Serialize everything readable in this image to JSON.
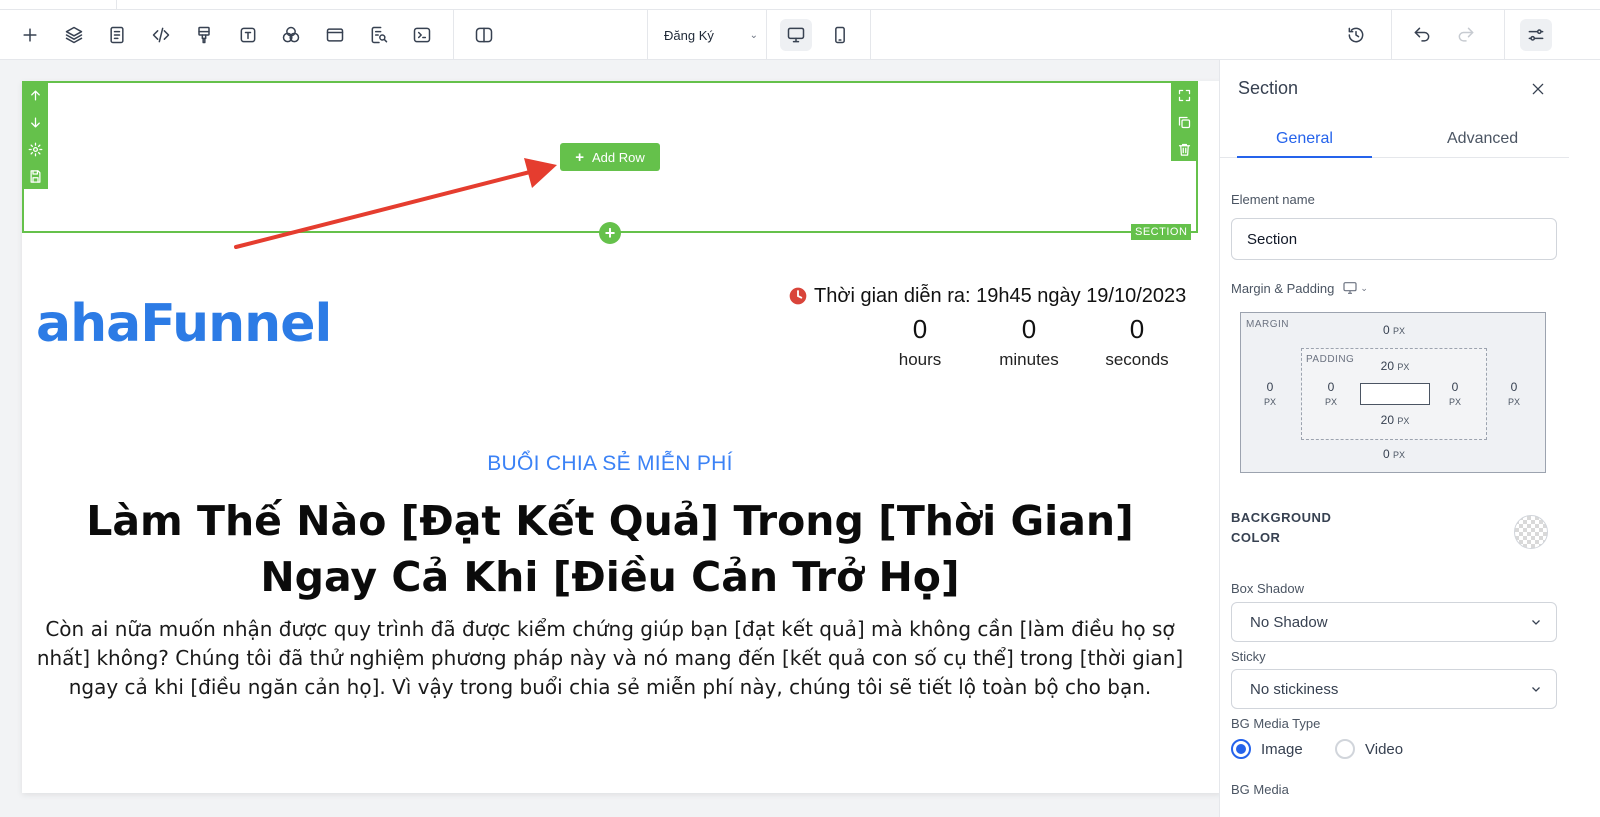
{
  "toolbar": {
    "page_select": "Đăng Ký",
    "icons": [
      "plus-icon",
      "layers-icon",
      "page-icon",
      "code-icon",
      "paint-icon",
      "text-icon",
      "theme-icon",
      "layout-icon",
      "seo-icon",
      "terminal-icon",
      "split-view-icon"
    ]
  },
  "canvas": {
    "add_row_label": "Add Row",
    "section_tag": "SECTION"
  },
  "content": {
    "logo": "ahaFunnel",
    "event_time": "Thời gian diễn ra: 19h45 ngày 19/10/2023",
    "countdown": [
      {
        "value": "0",
        "unit": "hours"
      },
      {
        "value": "0",
        "unit": "minutes"
      },
      {
        "value": "0",
        "unit": "seconds"
      }
    ],
    "subtitle": "BUỔI CHIA SẺ MIỄN PHÍ",
    "headline": "Làm Thế Nào [Đạt Kết Quả] Trong [Thời Gian] Ngay Cả Khi [Điều Cản Trở Họ]",
    "description": "Còn ai nữa muốn nhận được quy trình đã được kiểm chứng giúp bạn [đạt kết quả] mà không cần [làm điều họ sợ nhất] không? Chúng tôi đã thử nghiệm phương pháp này và nó mang đến [kết quả con số cụ thể] trong [thời gian] ngay cả khi [điều ngăn cản họ]. Vì vậy trong buổi chia sẻ miễn phí này, chúng tôi sẽ tiết lộ toàn bộ cho bạn."
  },
  "panel": {
    "title": "Section",
    "tabs": [
      "General",
      "Advanced"
    ],
    "element_name_label": "Element name",
    "element_name_value": "Section",
    "margin_padding_label": "Margin & Padding",
    "margin_label": "MARGIN",
    "padding_label": "PADDING",
    "unit": "PX",
    "margin": {
      "top": "0",
      "right": "0",
      "bottom": "0",
      "left": "0"
    },
    "padding": {
      "top": "20",
      "right": "0",
      "bottom": "20",
      "left": "0"
    },
    "background_color_label": "BACKGROUND COLOR",
    "box_shadow_label": "Box Shadow",
    "box_shadow_value": "No Shadow",
    "sticky_label": "Sticky",
    "sticky_value": "No stickiness",
    "bg_media_type_label": "BG Media Type",
    "bg_media_types": [
      "Image",
      "Video"
    ],
    "bg_media_type_selected": "Image",
    "bg_media_label": "BG Media"
  },
  "colors": {
    "accent": "#65c14b",
    "link": "#2563eb",
    "annotation_arrow": "#e53d2f"
  }
}
